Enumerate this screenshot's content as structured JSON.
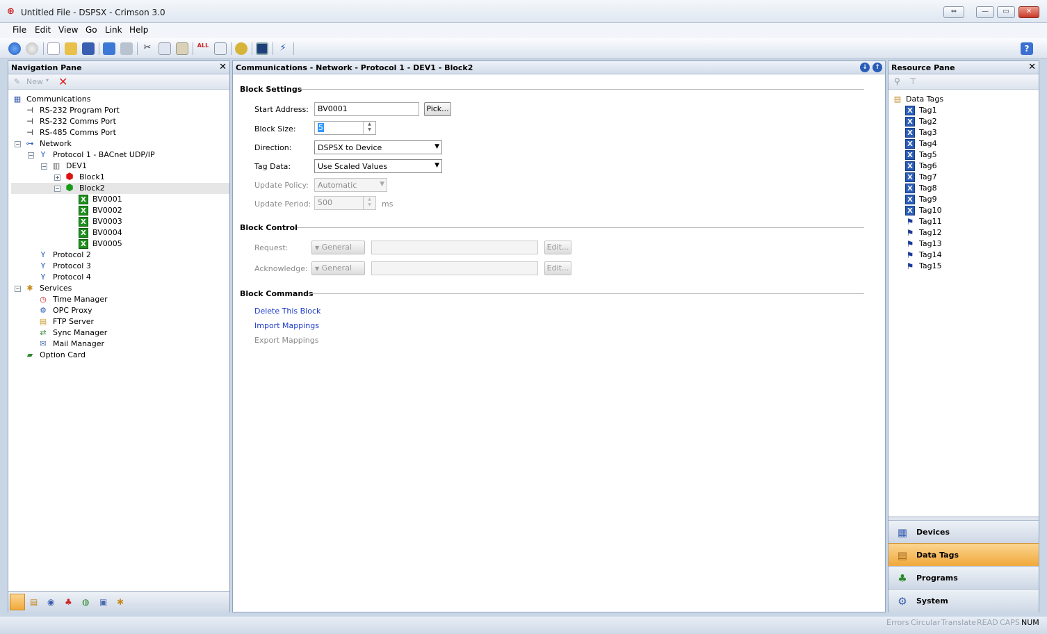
{
  "window": {
    "title": "Untitled File - DSPSX - Crimson 3.0"
  },
  "menu": [
    "File",
    "Edit",
    "View",
    "Go",
    "Link",
    "Help"
  ],
  "nav": {
    "title": "Navigation Pane",
    "new_label": "New",
    "tree": [
      {
        "label": "Communications"
      },
      {
        "label": "RS-232 Program Port"
      },
      {
        "label": "RS-232 Comms Port"
      },
      {
        "label": "RS-485 Comms Port"
      },
      {
        "label": "Network"
      },
      {
        "label": "Protocol 1 - BACnet UDP/IP"
      },
      {
        "label": "DEV1"
      },
      {
        "label": "Block1"
      },
      {
        "label": "Block2"
      },
      {
        "label": "BV0001"
      },
      {
        "label": "BV0002"
      },
      {
        "label": "BV0003"
      },
      {
        "label": "BV0004"
      },
      {
        "label": "BV0005"
      },
      {
        "label": "Protocol 2"
      },
      {
        "label": "Protocol 3"
      },
      {
        "label": "Protocol 4"
      },
      {
        "label": "Services"
      },
      {
        "label": "Time Manager"
      },
      {
        "label": "OPC Proxy"
      },
      {
        "label": "FTP Server"
      },
      {
        "label": "Sync Manager"
      },
      {
        "label": "Mail Manager"
      },
      {
        "label": "Option Card"
      }
    ]
  },
  "main": {
    "breadcrumb": "Communications - Network - Protocol 1 - DEV1 - Block2",
    "block_settings": {
      "heading": "Block Settings",
      "start_address_label": "Start Address:",
      "start_address_value": "BV0001",
      "pick_label": "Pick...",
      "block_size_label": "Block Size:",
      "block_size_value": "5",
      "direction_label": "Direction:",
      "direction_value": "DSPSX to Device",
      "tag_data_label": "Tag Data:",
      "tag_data_value": "Use Scaled Values",
      "update_policy_label": "Update Policy:",
      "update_policy_value": "Automatic",
      "update_period_label": "Update Period:",
      "update_period_value": "500",
      "update_period_unit": "ms"
    },
    "block_control": {
      "heading": "Block Control",
      "request_label": "Request:",
      "request_mode": "General",
      "acknowledge_label": "Acknowledge:",
      "acknowledge_mode": "General",
      "edit_label": "Edit..."
    },
    "block_commands": {
      "heading": "Block Commands",
      "delete": "Delete This Block",
      "import": "Import Mappings",
      "export": "Export Mappings"
    }
  },
  "resource": {
    "title": "Resource Pane",
    "root": "Data Tags",
    "tags": [
      "Tag1",
      "Tag2",
      "Tag3",
      "Tag4",
      "Tag5",
      "Tag6",
      "Tag7",
      "Tag8",
      "Tag9",
      "Tag10",
      "Tag11",
      "Tag12",
      "Tag13",
      "Tag14",
      "Tag15"
    ],
    "categories": [
      "Devices",
      "Data Tags",
      "Programs",
      "System"
    ],
    "active_category": "Data Tags"
  },
  "status": [
    "Errors",
    "Circular",
    "Translate",
    "READ",
    "CAPS",
    "NUM"
  ],
  "colors": {
    "active_category": "#f1a93a",
    "link": "#1b39c9",
    "selected_row": "#e6e6e6"
  }
}
